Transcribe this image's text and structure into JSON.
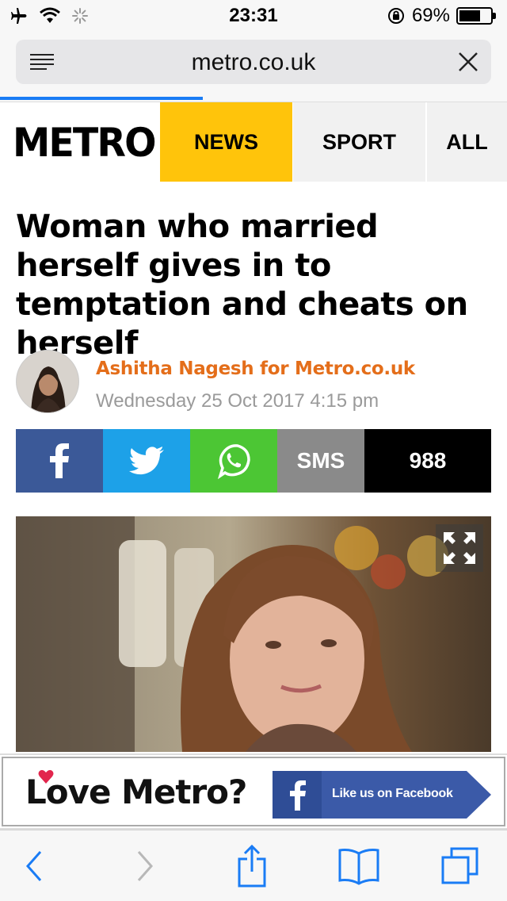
{
  "status_bar": {
    "time": "23:31",
    "battery_percent": "69%",
    "battery_level": 0.69,
    "icons": [
      "airplane-icon",
      "wifi-icon",
      "activity-spinner-icon",
      "rotation-lock-icon",
      "battery-icon"
    ]
  },
  "browser": {
    "url": "metro.co.uk",
    "load_progress": 0.4,
    "menu_icon": "reader-menu-icon",
    "close_icon": "close-icon"
  },
  "site_nav": {
    "logo": "METRO",
    "tabs": [
      {
        "label": "NEWS",
        "active": true
      },
      {
        "label": "SPORT",
        "active": false
      },
      {
        "label": "ALL",
        "active": false
      }
    ],
    "accent_color": "#ffc40b"
  },
  "article": {
    "headline": "Woman who married herself gives in to temptation and cheats on herself",
    "author": "Ashitha Nagesh for Metro.co.uk",
    "date": "Wednesday 25 Oct 2017 4:15 pm",
    "author_color": "#e46e1a"
  },
  "share": {
    "buttons": [
      {
        "name": "facebook",
        "icon": "facebook-icon",
        "color": "#3b5998"
      },
      {
        "name": "twitter",
        "icon": "twitter-icon",
        "color": "#1da1e8"
      },
      {
        "name": "whatsapp",
        "icon": "whatsapp-icon",
        "color": "#4cc634"
      },
      {
        "name": "sms",
        "label": "SMS",
        "color": "#8a8a8a"
      },
      {
        "name": "count",
        "label": "988",
        "color": "#000000"
      }
    ]
  },
  "image": {
    "expand_icon": "expand-icon"
  },
  "ad": {
    "text": "Love Metro?",
    "fb_label": "Like us on Facebook",
    "fb_color": "#3b5aa8"
  },
  "toolbar": {
    "icons": [
      "back-icon",
      "forward-icon",
      "share-icon",
      "bookmarks-icon",
      "tabs-icon"
    ],
    "tint": "#1a7cf5"
  }
}
